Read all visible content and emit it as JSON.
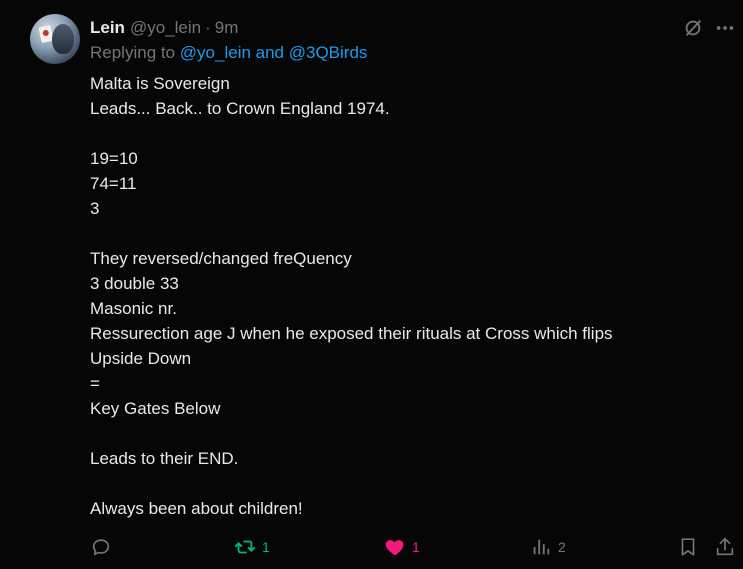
{
  "author": {
    "name": "Lein",
    "handle": "@yo_lein",
    "separator": "·",
    "time": "9m"
  },
  "reply": {
    "label": "Replying to",
    "mentions": "@yo_lein and @3QBirds"
  },
  "body_lines": [
    "Malta is Sovereign",
    "Leads... Back.. to Crown England 1974.",
    "",
    "19=10",
    "74=11",
    "3",
    "",
    "They reversed/changed freQuency",
    "3 double 33",
    "Masonic nr.",
    "Ressurection age J when he exposed their rituals at Cross which flips",
    "Upside Down",
    "=",
    "Key Gates Below",
    "",
    "Leads to their END.",
    "",
    "Always been about children!"
  ],
  "actions": {
    "reply": {
      "icon": "reply-icon",
      "count": ""
    },
    "retweet": {
      "icon": "retweet-icon",
      "count": "1",
      "color": "#00ba7c"
    },
    "like": {
      "icon": "heart-filled-icon",
      "count": "1",
      "color": "#f91880"
    },
    "views": {
      "icon": "views-icon",
      "count": "2"
    },
    "bookmark": {
      "icon": "bookmark-icon"
    },
    "share": {
      "icon": "share-icon"
    }
  },
  "colors": {
    "background": "#060607",
    "text": "#e7e9ea",
    "muted": "#71767b",
    "link": "#1d9bf0"
  }
}
